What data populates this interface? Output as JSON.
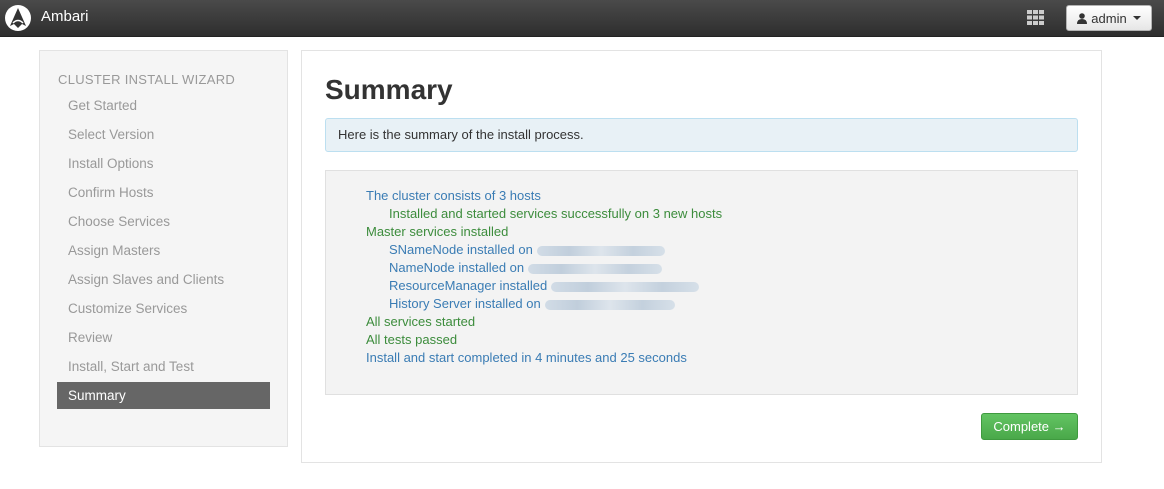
{
  "app": {
    "title": "Ambari"
  },
  "header": {
    "apps_icon": "grid-icon",
    "user_icon": "user-icon",
    "user_label": "admin"
  },
  "sidebar": {
    "title": "CLUSTER INSTALL WIZARD",
    "items": [
      {
        "label": "Get Started",
        "active": false
      },
      {
        "label": "Select Version",
        "active": false
      },
      {
        "label": "Install Options",
        "active": false
      },
      {
        "label": "Confirm Hosts",
        "active": false
      },
      {
        "label": "Choose Services",
        "active": false
      },
      {
        "label": "Assign Masters",
        "active": false
      },
      {
        "label": "Assign Slaves and Clients",
        "active": false
      },
      {
        "label": "Customize Services",
        "active": false
      },
      {
        "label": "Review",
        "active": false
      },
      {
        "label": "Install, Start and Test",
        "active": false
      },
      {
        "label": "Summary",
        "active": true
      }
    ]
  },
  "main": {
    "title": "Summary",
    "alert": "Here is the summary of the install process.",
    "summary": {
      "cluster_hosts": "The cluster consists of 3 hosts",
      "installed_started": "Installed and started services successfully on 3 new hosts",
      "master_services": "Master services installed",
      "snamenode": "SNameNode installed on",
      "namenode": "NameNode installed on",
      "resourcemanager": "ResourceManager installed",
      "historyserver": "History Server installed on",
      "all_started": "All services started",
      "all_tests": "All tests passed",
      "completed": "Install and start completed in 4 minutes and 25 seconds"
    },
    "complete_button": "Complete →"
  },
  "colors": {
    "navbar": "#333333",
    "link_blue": "#3a7cb4",
    "success_green": "#3c8c3c",
    "button_green": "#5bb75b",
    "active_step": "#666666"
  }
}
